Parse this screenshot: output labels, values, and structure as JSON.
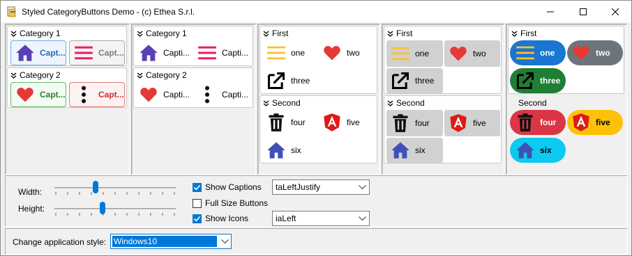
{
  "window": {
    "title": "Styled CategoryButtons Demo - (c) Ethea S.r.l."
  },
  "panel1": {
    "cat1": "Category 1",
    "cat2": "Category 2",
    "cat1_btn1": "Capt...",
    "cat1_btn2": "Capt...",
    "cat2_btn1": "Capt...",
    "cat2_btn2": "Capt..."
  },
  "panel2": {
    "cat1": "Category 1",
    "cat2": "Category 2",
    "cat1_btn1": "Capti...",
    "cat1_btn2": "Capti...",
    "cat2_btn1": "Capti...",
    "cat2_btn2": "Capti..."
  },
  "panel3": {
    "first": "First",
    "second": "Second",
    "one": "one",
    "two": "two",
    "three": "three",
    "four": "four",
    "five": "five",
    "six": "six"
  },
  "panel4": {
    "first": "First",
    "second": "Second",
    "one": "one",
    "two": "two",
    "three": "three",
    "four": "four",
    "five": "five",
    "six": "six"
  },
  "panel5": {
    "first": "First",
    "second": "Second",
    "one": "one",
    "two": "two",
    "three": "three",
    "four": "four",
    "five": "five",
    "six": "six"
  },
  "controls": {
    "width_label": "Width:",
    "height_label": "Height:",
    "width_value": 0.33,
    "height_value": 0.39,
    "show_captions": "Show Captions",
    "full_size": "Full Size Buttons",
    "show_icons": "Show Icons",
    "caption_align": "taLeftJustify",
    "icon_align": "iaLeft"
  },
  "status": {
    "style_label": "Change application style:",
    "style_value": "Windows10"
  },
  "colors": {
    "accent": "#0078d7",
    "home": "#5b3fb6",
    "heart": "#e53935",
    "menu_lines": "#e91e63",
    "lines_yellow": "#fbc02d",
    "angular": "#dd1b16",
    "blue_pill": "#1976d2",
    "gray_pill": "#6c757d",
    "green_pill": "#1e7e34",
    "red_pill": "#dc3545",
    "yellow_pill": "#ffc107",
    "cyan_pill": "#0dcaf0"
  }
}
